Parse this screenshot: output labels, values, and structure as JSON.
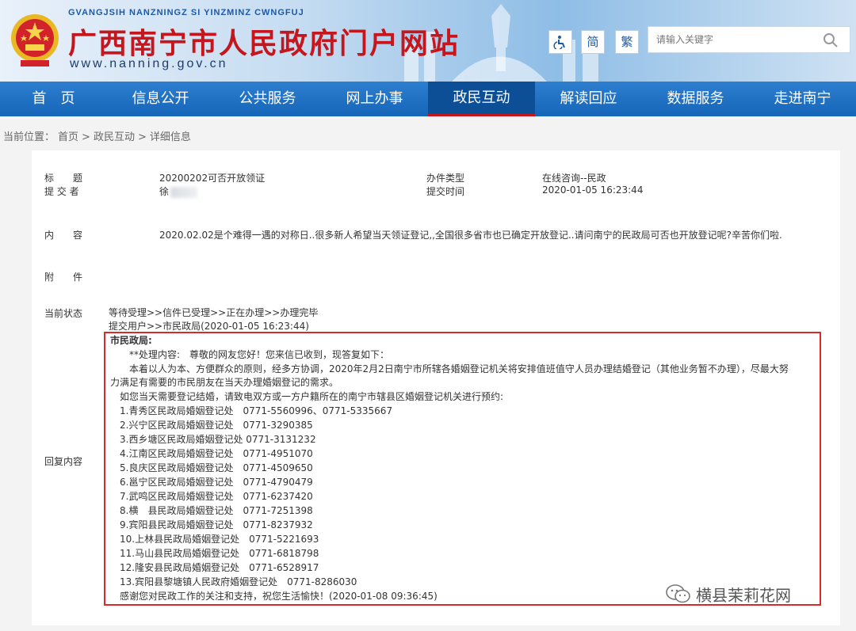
{
  "header": {
    "pinyin": "GVANGJSIH NANZNINGZ SI YINZMINZ CWNGFUJ",
    "title": "广西南宁市人民政府门户网站",
    "url": "www.nanning.gov.cn",
    "accessibility_icon": "accessibility-icon",
    "simplified_label": "简",
    "traditional_label": "繁",
    "search_placeholder": "请输入关键字"
  },
  "nav": {
    "items": [
      "首　页",
      "信息公开",
      "公共服务",
      "网上办事",
      "政民互动",
      "解读回应",
      "数据服务",
      "走进南宁"
    ],
    "active_index": 4
  },
  "breadcrumb": {
    "prefix": "当前位置：",
    "items": [
      "首页",
      "政民互动",
      "详细信息"
    ],
    "separator": ">"
  },
  "detail": {
    "title_label": "标　　题",
    "title_value": "20200202可否开放领证",
    "type_label": "办件类型",
    "type_value": "在线咨询--民政",
    "submitter_label": "提 交 者",
    "submitter_value": "徐",
    "submit_time_label": "提交时间",
    "submit_time_value": "2020-01-05 16:23:44",
    "content_label": "内　　容",
    "content_value": "2020.02.02是个难得一遇的对称日..很多新人希望当天领证登记,,全国很多省市也已确定开放登记..请问南宁的民政局可否也开放登记呢?辛苦你们啦.",
    "attachment_label": "附　　件",
    "status_label": "当前状态",
    "status_value": "等待受理>>信件已受理>>正在办理>>办理完毕",
    "status_detail": "提交用户>>市民政局(2020-01-05 16:23:44)",
    "reply_label": "回复内容"
  },
  "reply": {
    "department": "市民政局:",
    "lines": [
      "　　**处理内容:　尊敬的网友您好！您来信已收到，现答复如下：",
      "　　本着以人为本、方便群众的原则，经多方协调，2020年2月2日南宁市所辖各婚姻登记机关将安排值班值守人员办理结婚登记（其他业务暂不办理），尽最大努",
      "力满足有需要的市民朋友在当天办理婚姻登记的需求。",
      "　如您当天需要登记结婚，请致电双方或一方户籍所在的南宁市辖县区婚姻登记机关进行预约:",
      "　1.青秀区民政局婚姻登记处　0771-5560996、0771-5335667",
      "　2.兴宁区民政局婚姻登记处　0771-3290385",
      "　3.西乡塘区民政局婚姻登记处 0771-3131232",
      "　4.江南区民政局婚姻登记处　0771-4951070",
      "　5.良庆区民政局婚姻登记处　0771-4509650",
      "　6.邕宁区民政局婚姻登记处　0771-4790479",
      "　7.武鸣区民政局婚姻登记处　0771-6237420",
      "　8.横　县民政局婚姻登记处　0771-7251398",
      "　9.宾阳县民政局婚姻登记处　0771-8237932",
      "　10.上林县民政局婚姻登记处　0771-5221693",
      "　11.马山县民政局婚姻登记处　0771-6818798",
      "　12.隆安县民政局婚姻登记处　0771-6528917",
      "　13.宾阳县黎塘镇人民政府婚姻登记处　0771-8286030",
      "　感谢您对民政工作的关注和支持，祝您生活愉快！(2020-01-08 09:36:45)"
    ]
  },
  "watermark": {
    "icon": "wechat-icon",
    "text": "横县茉莉花网"
  }
}
